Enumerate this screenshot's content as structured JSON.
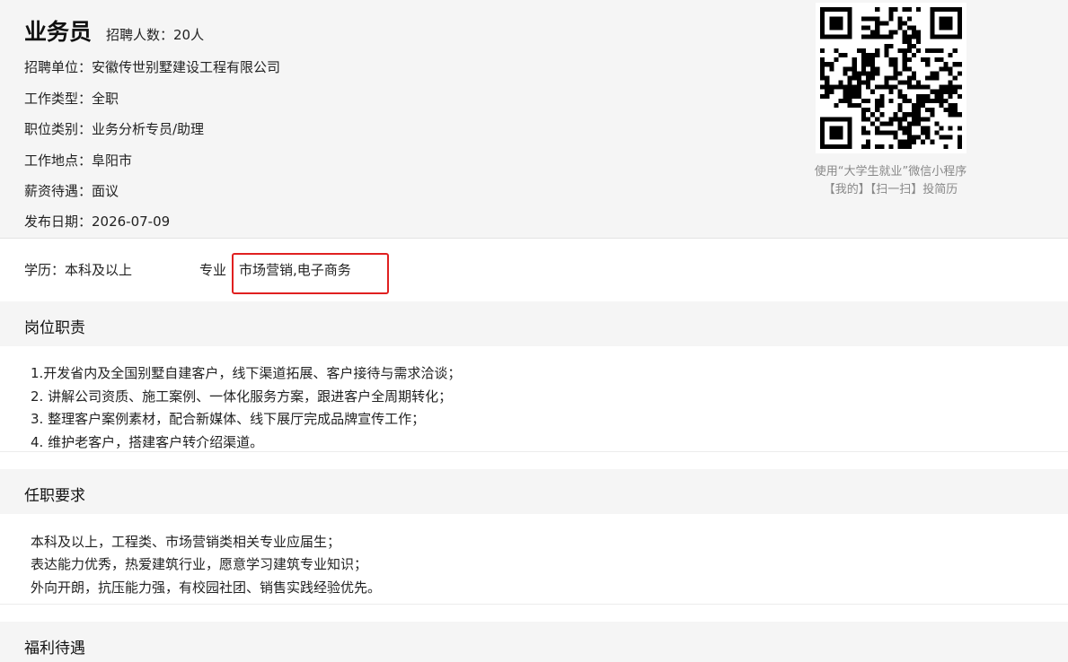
{
  "job": {
    "title": "业务员",
    "headcount": "招聘人数：20人",
    "company": "招聘单位：安徽传世别墅建设工程有限公司",
    "work_type": "工作类型：全职",
    "category": "职位类别：业务分析专员/助理",
    "location": "工作地点：阜阳市",
    "salary": "薪资待遇：面议",
    "publish_date": "发布日期：2026-07-09"
  },
  "qr": {
    "caption_line1": "使用“大学生就业”微信小程序",
    "caption_line2": "【我的】【扫一扫】投简历"
  },
  "requirements": {
    "education": "学历：本科及以上",
    "major_label": "专业",
    "major_value": "市场营销,电子商务"
  },
  "duties": {
    "heading": "岗位职责",
    "lines": [
      "1.开发省内及全国别墅自建客户，线下渠道拓展、客户接待与需求洽谈；",
      "2. 讲解公司资质、施工案例、一体化服务方案，跟进客户全周期转化；",
      "3. 整理客户案例素材，配合新媒体、线下展厅完成品牌宣传工作；",
      "4. 维护老客户，搭建客户转介绍渠道。"
    ]
  },
  "qualifications": {
    "heading": "任职要求",
    "lines": [
      "本科及以上，工程类、市场营销类相关专业应届生；",
      "表达能力优秀，热爱建筑行业，愿意学习建筑专业知识；",
      "外向开朗，抗压能力强，有校园社团、销售实践经验优先。"
    ]
  },
  "benefits": {
    "heading": "福利待遇"
  }
}
